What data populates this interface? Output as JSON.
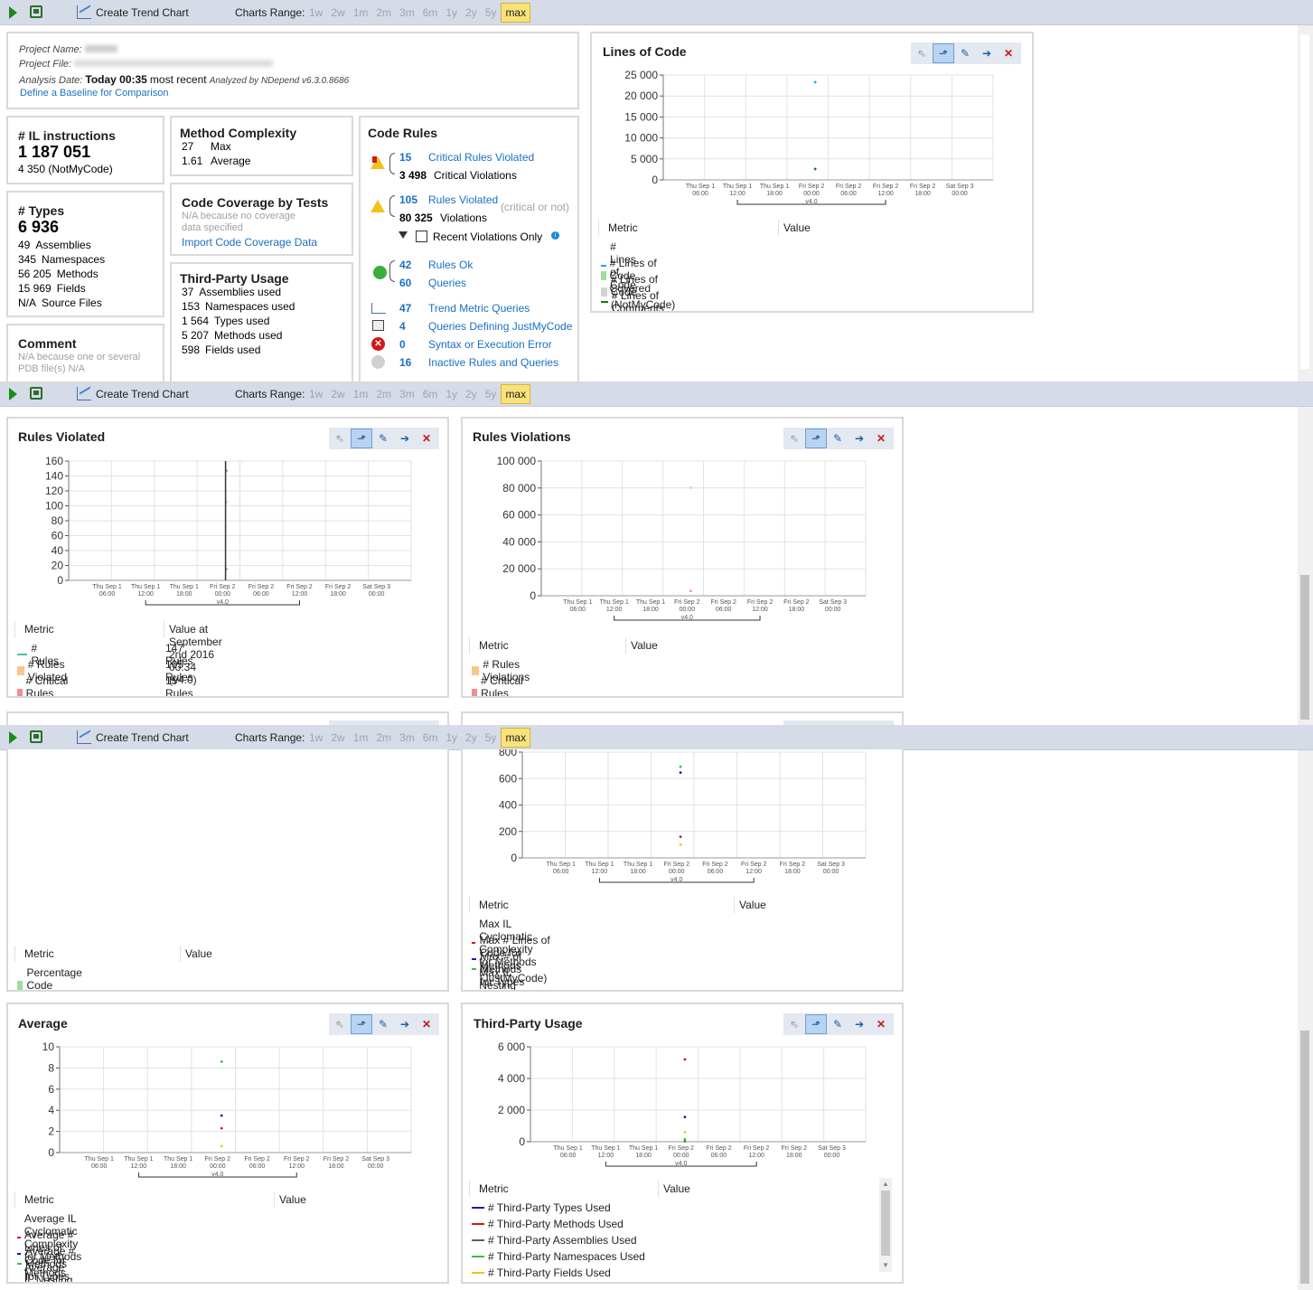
{
  "toolbar": {
    "create_trend": "Create Trend Chart",
    "charts_range": "Charts Range:",
    "ranges": [
      "1w",
      "2w",
      "1m",
      "2m",
      "3m",
      "6m",
      "1y",
      "2y",
      "5y",
      "max"
    ],
    "selected": "max"
  },
  "project": {
    "name_label": "Project Name:",
    "file_label": "Project File:",
    "date_label": "Analysis Date:",
    "date_value": "Today 00:35",
    "recent": "most recent",
    "analyzed": "Analyzed by NDepend v6.3.0.8686",
    "baseline_link": "Define a Baseline for Comparison"
  },
  "il": {
    "title": "# IL instructions",
    "value": "1 187 051",
    "notmycode": "4 350  (NotMyCode)"
  },
  "types": {
    "title": "# Types",
    "value": "6 936",
    "rows": [
      [
        "49",
        "Assemblies"
      ],
      [
        "345",
        "Namespaces"
      ],
      [
        "56 205",
        "Methods"
      ],
      [
        "15 969",
        "Fields"
      ],
      [
        "N/A",
        "Source Files"
      ]
    ]
  },
  "comment": {
    "title": "Comment",
    "note1": "N/A because one or several",
    "note2": "PDB file(s) N/A"
  },
  "complexity": {
    "title": "Method Complexity",
    "rows": [
      [
        "27",
        "Max"
      ],
      [
        "1.61",
        "Average"
      ]
    ]
  },
  "coverage": {
    "title": "Code Coverage by Tests",
    "note1": "N/A because no coverage",
    "note2": "data specified",
    "link": "Import Code Coverage Data"
  },
  "thirdparty": {
    "title": "Third-Party Usage",
    "rows": [
      [
        "37",
        "Assemblies used"
      ],
      [
        "153",
        "Namespaces used"
      ],
      [
        "1 564",
        "Types used"
      ],
      [
        "5 207",
        "Methods used"
      ],
      [
        "598",
        "Fields used"
      ]
    ]
  },
  "rules": {
    "title": "Code Rules",
    "crit_num": "15",
    "crit_label": "Critical Rules Violated",
    "crit_viol_num": "3 498",
    "crit_viol_label": "Critical Violations",
    "viol_num": "105",
    "viol_label": "Rules Violated",
    "viol_note": "(critical or not)",
    "viol_count": "80 325",
    "viol_count_label": "Violations",
    "recent_only": "Recent Violations Only",
    "ok_num": "42",
    "ok_label": "Rules Ok",
    "q_num": "60",
    "q_label": "Queries",
    "trend_num": "47",
    "trend_label": "Trend Metric Queries",
    "jmc_num": "4",
    "jmc_label": "Queries Defining JustMyCode",
    "err_num": "0",
    "err_label": "Syntax or Execution Error",
    "inactive_num": "16",
    "inactive_label": "Inactive Rules and Queries"
  },
  "xticks": [
    [
      "Thu Sep 1",
      "06:00"
    ],
    [
      "Thu Sep 1",
      "12:00"
    ],
    [
      "Thu Sep 1",
      "18:00"
    ],
    [
      "Fri Sep 2",
      "00:00"
    ],
    [
      "Fri Sep 2",
      "06:00"
    ],
    [
      "Fri Sep 2",
      "12:00"
    ],
    [
      "Fri Sep 2",
      "18:00"
    ],
    [
      "Sat Sep 3",
      "00:00"
    ]
  ],
  "version": "v4.0",
  "legend_hdr": {
    "metric": "Metric",
    "value": "Value"
  },
  "loc": {
    "title": "Lines of Code",
    "yticks": [
      "25 000",
      "20 000",
      "15 000",
      "10 000",
      "5 000",
      "0"
    ],
    "legend": [
      {
        "label": "# Lines of Code",
        "color": "#1ea7e8",
        "kind": "line"
      },
      {
        "label": "# Lines of Code Covered",
        "color": "#9fde9f",
        "kind": "sq"
      },
      {
        "label": "# Lines of Code (NotMyCode)",
        "color": "#d3d3d3",
        "kind": "sq"
      },
      {
        "label": "# Lines of Comments",
        "color": "#0f7a0f",
        "kind": "line"
      }
    ]
  },
  "rules_violated": {
    "title": "Rules Violated",
    "yticks": [
      "160",
      "140",
      "120",
      "100",
      "80",
      "60",
      "40",
      "20",
      "0"
    ],
    "value_hdr": "Value at September 2nd 2016  00:34  (v4.0)",
    "legend": [
      {
        "label": "# Rules",
        "color": "#4fbf9f",
        "kind": "line",
        "value": "147 Rules"
      },
      {
        "label": "# Rules Violated",
        "color": "#f8c68a",
        "kind": "sq",
        "value": "105 Rules"
      },
      {
        "label": "# Critical Rules Violated",
        "color": "#f09090",
        "kind": "sq",
        "value": "15 Rules"
      }
    ]
  },
  "rules_violations": {
    "title": "Rules Violations",
    "yticks": [
      "100 000",
      "80 000",
      "60 000",
      "40 000",
      "20 000",
      "0"
    ],
    "legend": [
      {
        "label": "# Rules Violations",
        "color": "#f8c68a",
        "kind": "sq"
      },
      {
        "label": "# Critical Rules Violations",
        "color": "#f09090",
        "kind": "sq"
      }
    ]
  },
  "coverage_chart": {
    "legend": [
      {
        "label": "Percentage Code Coverage",
        "color": "#9fde9f",
        "kind": "sq"
      }
    ]
  },
  "max_chart": {
    "yticks": [
      "800",
      "600",
      "400",
      "200",
      "0"
    ],
    "legend": [
      {
        "label": "Max IL Cyclomatic Complexity for Methods",
        "color": "#d01818",
        "kind": "line"
      },
      {
        "label": "Max # Lines of Code for Methods (JustMyCode)",
        "color": "#1a1ab0",
        "kind": "line"
      },
      {
        "label": "Max # of Methods for Types",
        "color": "#3cc03c",
        "kind": "line"
      },
      {
        "label": "Max IL Nesting Depth for Methods",
        "color": "#f2c21a",
        "kind": "line"
      }
    ]
  },
  "average": {
    "title": "Average",
    "yticks": [
      "10",
      "8",
      "6",
      "4",
      "2",
      "0"
    ],
    "legend": [
      {
        "label": "Average IL Cyclomatic Complexity for Methods",
        "color": "#d01818",
        "kind": "line"
      },
      {
        "label": "Average # Lines of Code for Methods",
        "color": "#1a1ab0",
        "kind": "line"
      },
      {
        "label": "Average # Methods for Types",
        "color": "#3cc03c",
        "kind": "line"
      },
      {
        "label": "Average IL Nesting Depth for Methods",
        "color": "#f2c21a",
        "kind": "line"
      }
    ]
  },
  "tp_chart": {
    "title": "Third-Party Usage",
    "yticks": [
      "6 000",
      "4 000",
      "2 000",
      "0"
    ],
    "legend": [
      {
        "label": "# Third-Party Types Used",
        "color": "#1a1ab0",
        "kind": "line"
      },
      {
        "label": "# Third-Party Methods Used",
        "color": "#d01818",
        "kind": "line"
      },
      {
        "label": "# Third-Party Assemblies Used",
        "color": "#606060",
        "kind": "line"
      },
      {
        "label": "# Third-Party Namespaces Used",
        "color": "#3cc03c",
        "kind": "line"
      },
      {
        "label": "# Third-Party Fields Used",
        "color": "#f2c21a",
        "kind": "line"
      }
    ]
  },
  "chart_data": [
    {
      "type": "scatter",
      "title": "Lines of Code",
      "ylim": [
        0,
        25000
      ],
      "series": [
        {
          "name": "# Lines of Code",
          "x": [
            "Fri Sep 2 00:34"
          ],
          "y": [
            23300
          ]
        },
        {
          "name": "# Lines of Comments",
          "x": [
            "Fri Sep 2 00:34"
          ],
          "y": [
            2600
          ]
        }
      ]
    },
    {
      "type": "scatter",
      "title": "Rules Violated",
      "ylim": [
        0,
        160
      ],
      "series": [
        {
          "name": "# Rules",
          "y": [
            147
          ]
        },
        {
          "name": "# Rules Violated",
          "y": [
            105
          ]
        },
        {
          "name": "# Critical Rules Violated",
          "y": [
            15
          ]
        }
      ]
    },
    {
      "type": "scatter",
      "title": "Rules Violations",
      "ylim": [
        0,
        100000
      ],
      "series": [
        {
          "name": "# Rules Violations",
          "y": [
            80325
          ]
        },
        {
          "name": "# Critical Rules Violations",
          "y": [
            3498
          ]
        }
      ]
    },
    {
      "type": "scatter",
      "ylim": [
        0,
        800
      ],
      "series": [
        {
          "name": "Max IL Cyclomatic Complexity for Methods",
          "y": [
            160
          ]
        },
        {
          "name": "Max # Lines of Code for Methods (JustMyCode)",
          "y": [
            645
          ]
        },
        {
          "name": "Max # of Methods for Types",
          "y": [
            690
          ]
        },
        {
          "name": "Max IL Nesting Depth for Methods",
          "y": [
            100
          ]
        }
      ]
    },
    {
      "type": "scatter",
      "title": "Average",
      "ylim": [
        0,
        10
      ],
      "series": [
        {
          "name": "Average IL Cyclomatic Complexity for Methods",
          "y": [
            2.3
          ]
        },
        {
          "name": "Average # Lines of Code for Methods",
          "y": [
            3.5
          ]
        },
        {
          "name": "Average # Methods for Types",
          "y": [
            8.6
          ]
        },
        {
          "name": "Average IL Nesting Depth for Methods",
          "y": [
            0.6
          ]
        }
      ]
    },
    {
      "type": "scatter",
      "title": "Third-Party Usage",
      "ylim": [
        0,
        6000
      ],
      "series": [
        {
          "name": "# Third-Party Types Used",
          "y": [
            1564
          ]
        },
        {
          "name": "# Third-Party Methods Used",
          "y": [
            5207
          ]
        },
        {
          "name": "# Third-Party Assemblies Used",
          "y": [
            37
          ]
        },
        {
          "name": "# Third-Party Namespaces Used",
          "y": [
            153
          ]
        },
        {
          "name": "# Third-Party Fields Used",
          "y": [
            598
          ]
        }
      ]
    }
  ]
}
